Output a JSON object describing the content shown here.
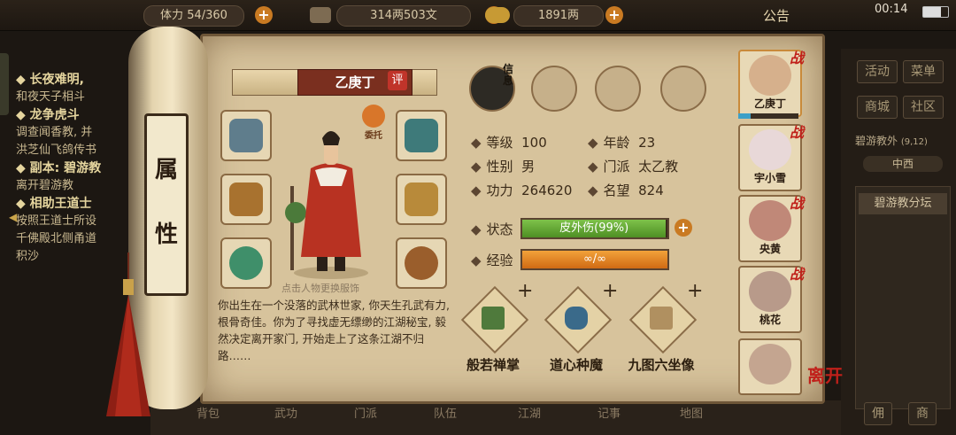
{
  "topbar": {
    "stamina": "54/360",
    "stamina_prefix": "体力",
    "money": "314两503文",
    "gold": "1891两",
    "notice": "公告",
    "clock": "00:14"
  },
  "quests": [
    {
      "head": "◆ 长夜难明,",
      "text": "和夜天子相斗"
    },
    {
      "head": "◆ 龙争虎斗",
      "text": "调查闻香教, 并\n洪芝仙飞鸽传书"
    },
    {
      "head": "◆ 副本: 碧游教",
      "text": "离开碧游教"
    },
    {
      "head": "◆ 相助王道士",
      "text": "按照王道士所设\n千佛殿北侧甬道\n积沙"
    }
  ],
  "right_panel": {
    "buttons": [
      "活动",
      "菜单",
      "商城",
      "社区"
    ],
    "location": "碧游教外",
    "coords": "(9,12)",
    "direction": "中西",
    "target": "碧游教分坛",
    "bottom": [
      "佣",
      "商"
    ]
  },
  "scroll": {
    "title_chars": [
      "属",
      "性"
    ]
  },
  "character": {
    "name": "乙庚丁",
    "rate_label": "评",
    "delegate_label": "委托",
    "change_hint": "点击人物更换服饰",
    "story": "你出生在一个没落的武林世家, 你天生孔武有力, 根骨奇佳。你为了寻找虚无缥缈的江湖秘宝, 毅然决定离开家门, 开始走上了这条江湖不归路……"
  },
  "tabs": {
    "info": "信息"
  },
  "stats": {
    "level_label": "等级",
    "level": "100",
    "age_label": "年龄",
    "age": "23",
    "gender_label": "性别",
    "gender": "男",
    "sect_label": "门派",
    "sect": "太乙教",
    "power_label": "功力",
    "power": "264620",
    "fame_label": "名望",
    "fame": "824",
    "status_label": "状态",
    "status": "皮外伤(99%)",
    "status_fill": 0.99,
    "exp_label": "经验",
    "exp": "∞/∞",
    "exp_fill": 1.0
  },
  "skills": [
    {
      "name": "般若禅掌"
    },
    {
      "name": "道心种魔"
    },
    {
      "name": "九图六坐像"
    }
  ],
  "team": [
    {
      "name": "乙庚丁",
      "tag": "战"
    },
    {
      "name": "宇小雪",
      "tag": "战"
    },
    {
      "name": "央黄",
      "tag": "战"
    },
    {
      "name": "桃花",
      "tag": "战"
    },
    {
      "name": "",
      "tag": ""
    }
  ],
  "leave_label": "离开",
  "bottom_bar": [
    "背包",
    "武功",
    "门派",
    "队伍",
    "江湖",
    "记事",
    "地图"
  ]
}
